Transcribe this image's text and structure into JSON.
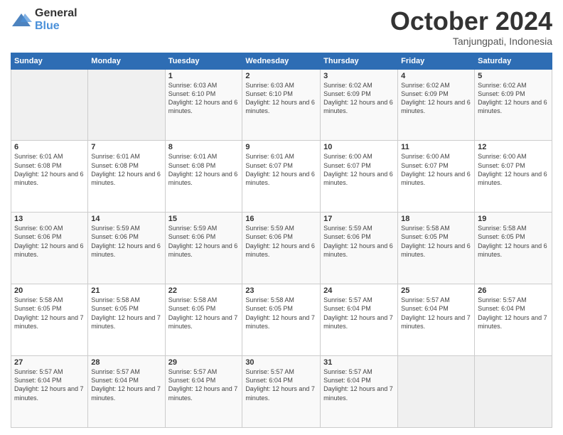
{
  "header": {
    "logo_general": "General",
    "logo_blue": "Blue",
    "month": "October 2024",
    "location": "Tanjungpati, Indonesia"
  },
  "weekdays": [
    "Sunday",
    "Monday",
    "Tuesday",
    "Wednesday",
    "Thursday",
    "Friday",
    "Saturday"
  ],
  "weeks": [
    [
      {
        "day": "",
        "sunrise": "",
        "sunset": "",
        "daylight": ""
      },
      {
        "day": "",
        "sunrise": "",
        "sunset": "",
        "daylight": ""
      },
      {
        "day": "1",
        "sunrise": "Sunrise: 6:03 AM",
        "sunset": "Sunset: 6:10 PM",
        "daylight": "Daylight: 12 hours and 6 minutes."
      },
      {
        "day": "2",
        "sunrise": "Sunrise: 6:03 AM",
        "sunset": "Sunset: 6:10 PM",
        "daylight": "Daylight: 12 hours and 6 minutes."
      },
      {
        "day": "3",
        "sunrise": "Sunrise: 6:02 AM",
        "sunset": "Sunset: 6:09 PM",
        "daylight": "Daylight: 12 hours and 6 minutes."
      },
      {
        "day": "4",
        "sunrise": "Sunrise: 6:02 AM",
        "sunset": "Sunset: 6:09 PM",
        "daylight": "Daylight: 12 hours and 6 minutes."
      },
      {
        "day": "5",
        "sunrise": "Sunrise: 6:02 AM",
        "sunset": "Sunset: 6:09 PM",
        "daylight": "Daylight: 12 hours and 6 minutes."
      }
    ],
    [
      {
        "day": "6",
        "sunrise": "Sunrise: 6:01 AM",
        "sunset": "Sunset: 6:08 PM",
        "daylight": "Daylight: 12 hours and 6 minutes."
      },
      {
        "day": "7",
        "sunrise": "Sunrise: 6:01 AM",
        "sunset": "Sunset: 6:08 PM",
        "daylight": "Daylight: 12 hours and 6 minutes."
      },
      {
        "day": "8",
        "sunrise": "Sunrise: 6:01 AM",
        "sunset": "Sunset: 6:08 PM",
        "daylight": "Daylight: 12 hours and 6 minutes."
      },
      {
        "day": "9",
        "sunrise": "Sunrise: 6:01 AM",
        "sunset": "Sunset: 6:07 PM",
        "daylight": "Daylight: 12 hours and 6 minutes."
      },
      {
        "day": "10",
        "sunrise": "Sunrise: 6:00 AM",
        "sunset": "Sunset: 6:07 PM",
        "daylight": "Daylight: 12 hours and 6 minutes."
      },
      {
        "day": "11",
        "sunrise": "Sunrise: 6:00 AM",
        "sunset": "Sunset: 6:07 PM",
        "daylight": "Daylight: 12 hours and 6 minutes."
      },
      {
        "day": "12",
        "sunrise": "Sunrise: 6:00 AM",
        "sunset": "Sunset: 6:07 PM",
        "daylight": "Daylight: 12 hours and 6 minutes."
      }
    ],
    [
      {
        "day": "13",
        "sunrise": "Sunrise: 6:00 AM",
        "sunset": "Sunset: 6:06 PM",
        "daylight": "Daylight: 12 hours and 6 minutes."
      },
      {
        "day": "14",
        "sunrise": "Sunrise: 5:59 AM",
        "sunset": "Sunset: 6:06 PM",
        "daylight": "Daylight: 12 hours and 6 minutes."
      },
      {
        "day": "15",
        "sunrise": "Sunrise: 5:59 AM",
        "sunset": "Sunset: 6:06 PM",
        "daylight": "Daylight: 12 hours and 6 minutes."
      },
      {
        "day": "16",
        "sunrise": "Sunrise: 5:59 AM",
        "sunset": "Sunset: 6:06 PM",
        "daylight": "Daylight: 12 hours and 6 minutes."
      },
      {
        "day": "17",
        "sunrise": "Sunrise: 5:59 AM",
        "sunset": "Sunset: 6:06 PM",
        "daylight": "Daylight: 12 hours and 6 minutes."
      },
      {
        "day": "18",
        "sunrise": "Sunrise: 5:58 AM",
        "sunset": "Sunset: 6:05 PM",
        "daylight": "Daylight: 12 hours and 6 minutes."
      },
      {
        "day": "19",
        "sunrise": "Sunrise: 5:58 AM",
        "sunset": "Sunset: 6:05 PM",
        "daylight": "Daylight: 12 hours and 6 minutes."
      }
    ],
    [
      {
        "day": "20",
        "sunrise": "Sunrise: 5:58 AM",
        "sunset": "Sunset: 6:05 PM",
        "daylight": "Daylight: 12 hours and 7 minutes."
      },
      {
        "day": "21",
        "sunrise": "Sunrise: 5:58 AM",
        "sunset": "Sunset: 6:05 PM",
        "daylight": "Daylight: 12 hours and 7 minutes."
      },
      {
        "day": "22",
        "sunrise": "Sunrise: 5:58 AM",
        "sunset": "Sunset: 6:05 PM",
        "daylight": "Daylight: 12 hours and 7 minutes."
      },
      {
        "day": "23",
        "sunrise": "Sunrise: 5:58 AM",
        "sunset": "Sunset: 6:05 PM",
        "daylight": "Daylight: 12 hours and 7 minutes."
      },
      {
        "day": "24",
        "sunrise": "Sunrise: 5:57 AM",
        "sunset": "Sunset: 6:04 PM",
        "daylight": "Daylight: 12 hours and 7 minutes."
      },
      {
        "day": "25",
        "sunrise": "Sunrise: 5:57 AM",
        "sunset": "Sunset: 6:04 PM",
        "daylight": "Daylight: 12 hours and 7 minutes."
      },
      {
        "day": "26",
        "sunrise": "Sunrise: 5:57 AM",
        "sunset": "Sunset: 6:04 PM",
        "daylight": "Daylight: 12 hours and 7 minutes."
      }
    ],
    [
      {
        "day": "27",
        "sunrise": "Sunrise: 5:57 AM",
        "sunset": "Sunset: 6:04 PM",
        "daylight": "Daylight: 12 hours and 7 minutes."
      },
      {
        "day": "28",
        "sunrise": "Sunrise: 5:57 AM",
        "sunset": "Sunset: 6:04 PM",
        "daylight": "Daylight: 12 hours and 7 minutes."
      },
      {
        "day": "29",
        "sunrise": "Sunrise: 5:57 AM",
        "sunset": "Sunset: 6:04 PM",
        "daylight": "Daylight: 12 hours and 7 minutes."
      },
      {
        "day": "30",
        "sunrise": "Sunrise: 5:57 AM",
        "sunset": "Sunset: 6:04 PM",
        "daylight": "Daylight: 12 hours and 7 minutes."
      },
      {
        "day": "31",
        "sunrise": "Sunrise: 5:57 AM",
        "sunset": "Sunset: 6:04 PM",
        "daylight": "Daylight: 12 hours and 7 minutes."
      },
      {
        "day": "",
        "sunrise": "",
        "sunset": "",
        "daylight": ""
      },
      {
        "day": "",
        "sunrise": "",
        "sunset": "",
        "daylight": ""
      }
    ]
  ]
}
